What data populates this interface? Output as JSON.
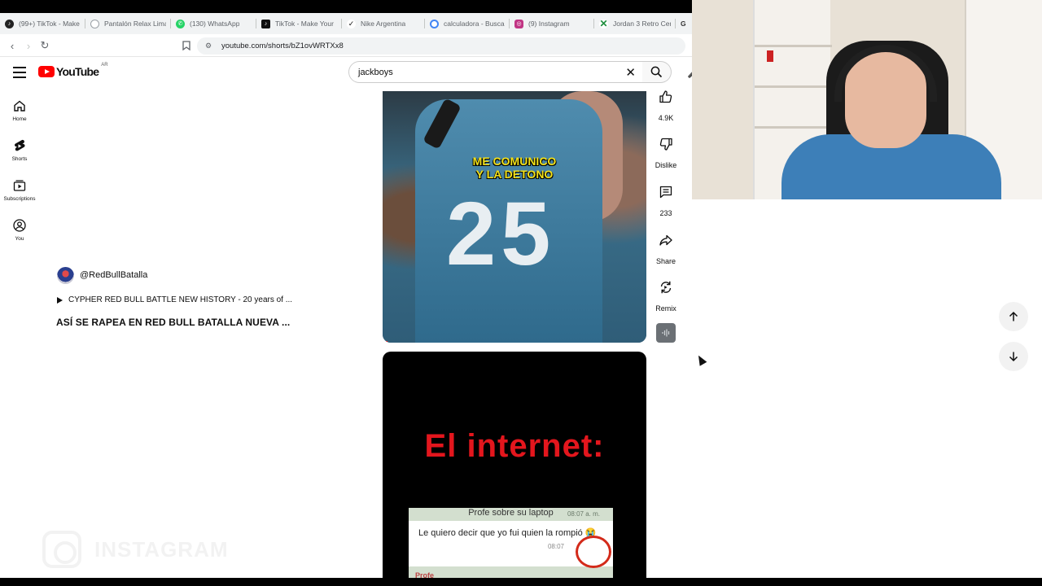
{
  "browser": {
    "tabs": [
      {
        "label": "(99+) TikTok - Make",
        "icon": "tiktok-icon",
        "color": "#222222"
      },
      {
        "label": "Pantalón Relax Lima",
        "icon": "globe-icon",
        "color": "#9aa0a6"
      },
      {
        "label": "(130) WhatsApp",
        "icon": "whatsapp-icon",
        "color": "#25d366"
      },
      {
        "label": "TikTok - Make Your",
        "icon": "tiktok-icon",
        "color": "#111111"
      },
      {
        "label": "Nike Argentina",
        "icon": "nike-icon",
        "color": "#111111"
      },
      {
        "label": "calculadora - Busca",
        "icon": "google-icon",
        "color": "#4285f4"
      },
      {
        "label": "(9) Instagram",
        "icon": "instagram-icon",
        "color": "#c13584"
      },
      {
        "label": "Jordan 3 Retro Cem",
        "icon": "x-icon",
        "color": "#1e8e3e"
      },
      {
        "label": "G",
        "icon": "google-icon",
        "color": "#5f6368"
      }
    ],
    "url": "youtube.com/shorts/bZ1ovWRTXx8"
  },
  "header": {
    "logo_text": "YouTube",
    "country_code": "AR",
    "search_value": "jackboys"
  },
  "rail": {
    "items": [
      {
        "label": "Home",
        "icon": "home-icon"
      },
      {
        "label": "Shorts",
        "icon": "shorts-icon"
      },
      {
        "label": "Subscriptions",
        "icon": "subscriptions-icon"
      },
      {
        "label": "You",
        "icon": "you-icon"
      }
    ]
  },
  "short": {
    "channel": "@RedBullBatalla",
    "sound": "CYPHER RED BULL BATTLE NEW HISTORY - 20 years of ...",
    "title": "ASÍ SE RAPEA EN RED BULL BATALLA NUEVA ...",
    "overlay_line1": "ME COMUNICO",
    "overlay_line2": "Y LA DETONO",
    "jersey_number": "25",
    "progress": 0.02
  },
  "actions": {
    "like_count": "4.9K",
    "dislike_label": "Dislike",
    "comments_count": "233",
    "share_label": "Share",
    "remix_label": "Remix"
  },
  "next_short": {
    "title": "El internet:",
    "chat_header": "Profe sobre su laptop",
    "chat_time": "08:07 a. m.",
    "chat_message": "Le quiero decir que yo fui quien la rompió 😭",
    "chat_time_short": "08:07",
    "chat_footer": "Profe"
  },
  "watermark": {
    "text": "INSTAGRAM"
  },
  "colors": {
    "accent": "#ff0000",
    "overlay_text": "#f2e11a",
    "next_title": "#e3161d"
  }
}
